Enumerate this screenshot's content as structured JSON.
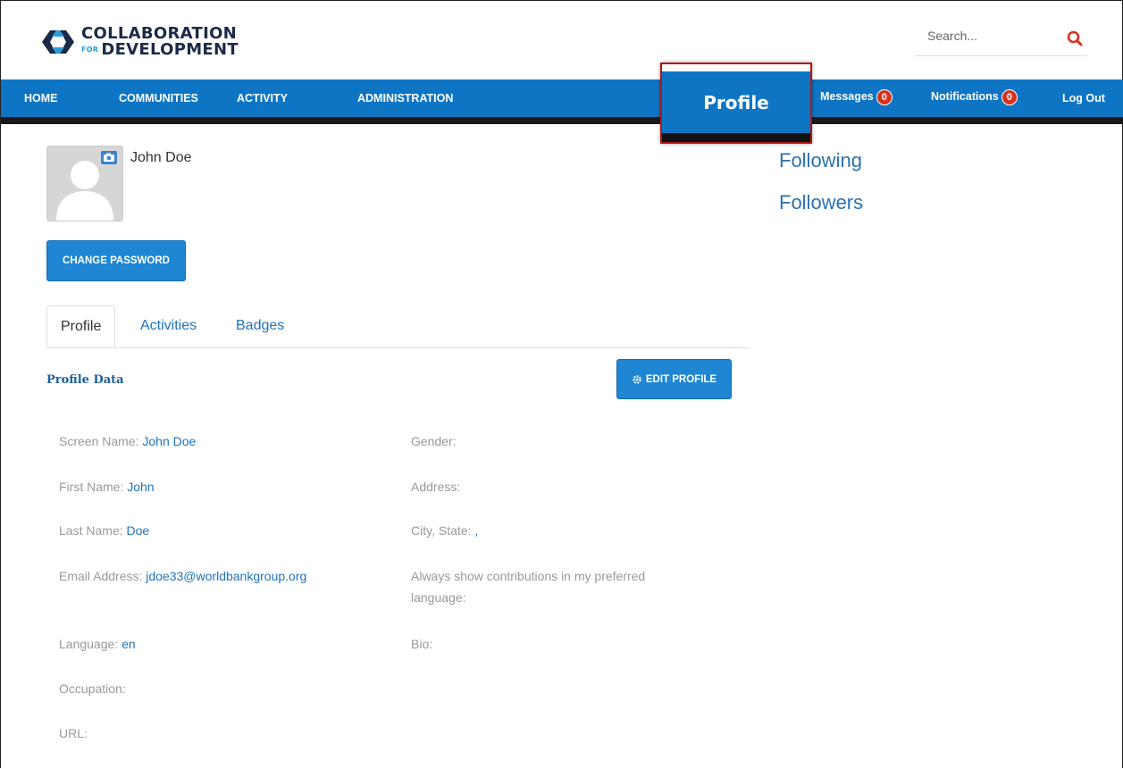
{
  "header": {
    "logo_line1": "COLLABORATION",
    "logo_for": "FOR",
    "logo_line2": "DEVELOPMENT",
    "search_placeholder": "Search..."
  },
  "nav": {
    "home": "HOME",
    "communities": "COMMUNITIES",
    "activity": "ACTIVITY",
    "administration": "ADMINISTRATION",
    "profile": "Profile",
    "messages": "Messages",
    "messages_count": "0",
    "notifications": "Notifications",
    "notifications_count": "0",
    "logout": "Log Out"
  },
  "user": {
    "name": "John Doe",
    "change_password": "CHANGE PASSWORD"
  },
  "tabs": [
    "Profile",
    "Activities",
    "Badges"
  ],
  "profile_data": {
    "title": "Profile Data",
    "edit_button": "EDIT PROFILE",
    "screen_name_label": "Screen Name: ",
    "screen_name": "John Doe",
    "first_name_label": "First Name: ",
    "first_name": "John",
    "last_name_label": "Last Name: ",
    "last_name": "Doe",
    "email_label": "Email Address: ",
    "email": "jdoe33@worldbankgroup.org",
    "language_label": "Language: ",
    "language": "en",
    "occupation_label": "Occupation:",
    "url_label": "URL:",
    "gender_label": "Gender:",
    "address_label": "Address:",
    "city_state_label": "City, State: ",
    "city_state": ",",
    "contrib_label_1": "Always show contributions in my preferred",
    "contrib_label_2": "language:",
    "bio_label": "Bio:"
  },
  "side": {
    "following": "Following",
    "followers": "Followers"
  },
  "colors": {
    "nav_blue": "#0e75c4",
    "badge_red": "#d8321f",
    "highlight_border": "#b01616",
    "link_blue": "#1e73be"
  }
}
